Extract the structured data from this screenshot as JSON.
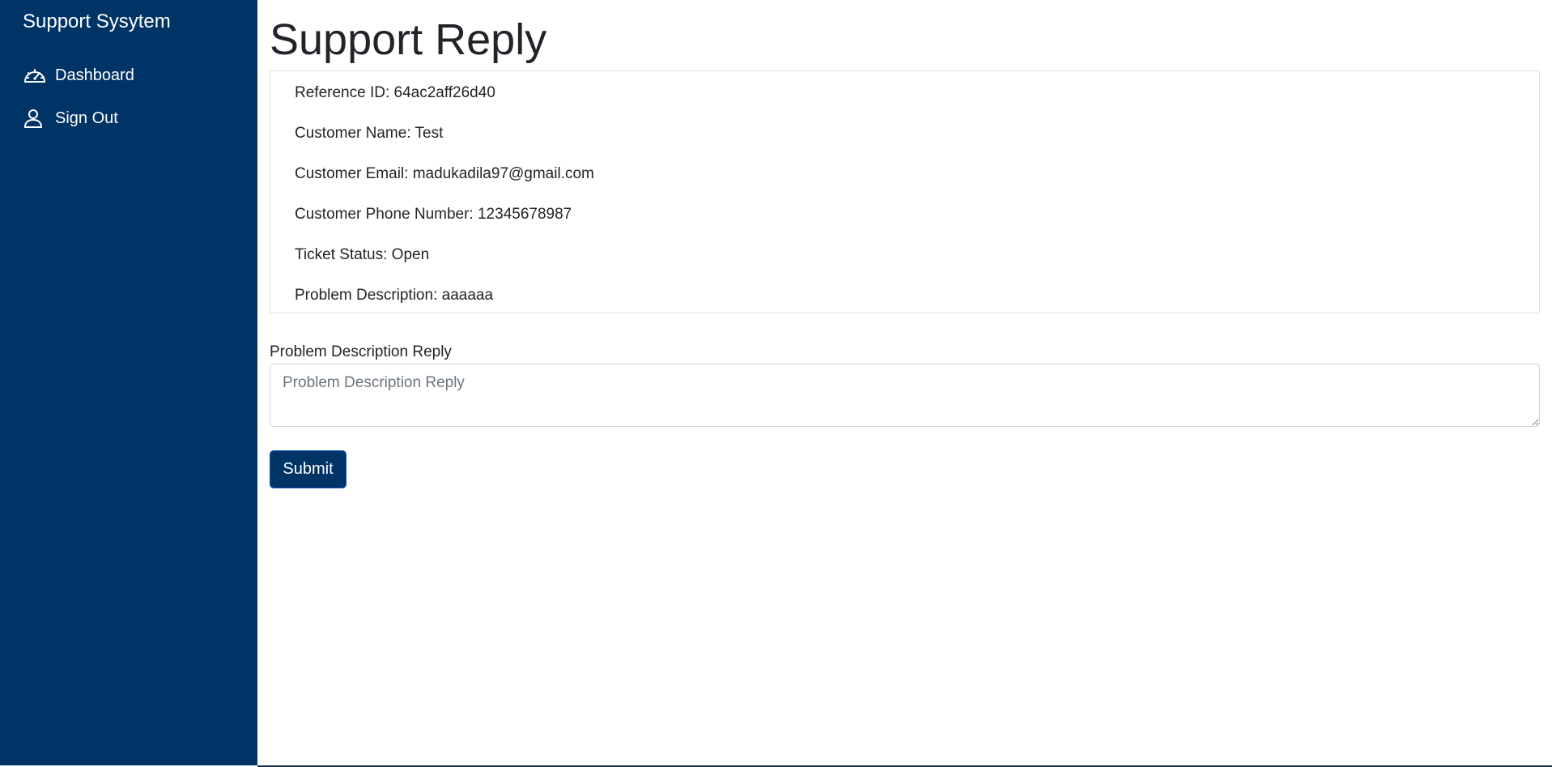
{
  "sidebar": {
    "brand": "Support Sysytem",
    "items": [
      {
        "label": "Dashboard",
        "icon": "speedometer-icon"
      },
      {
        "label": "Sign Out",
        "icon": "person-icon"
      }
    ]
  },
  "main": {
    "title": "Support Reply",
    "details": {
      "reference_id": "Reference ID: 64ac2aff26d40",
      "customer_name": "Customer Name: Test",
      "customer_email": "Customer Email: madukadila97@gmail.com",
      "customer_phone": "Customer Phone Number: 12345678987",
      "ticket_status": "Ticket Status: Open",
      "problem_description": "Problem Description: aaaaaa"
    },
    "reply": {
      "label": "Problem Description Reply",
      "placeholder": "Problem Description Reply",
      "value": ""
    },
    "submit_label": "Submit"
  },
  "colors": {
    "sidebar_bg": "#003366",
    "button_bg": "#003366",
    "text": "#212529"
  }
}
